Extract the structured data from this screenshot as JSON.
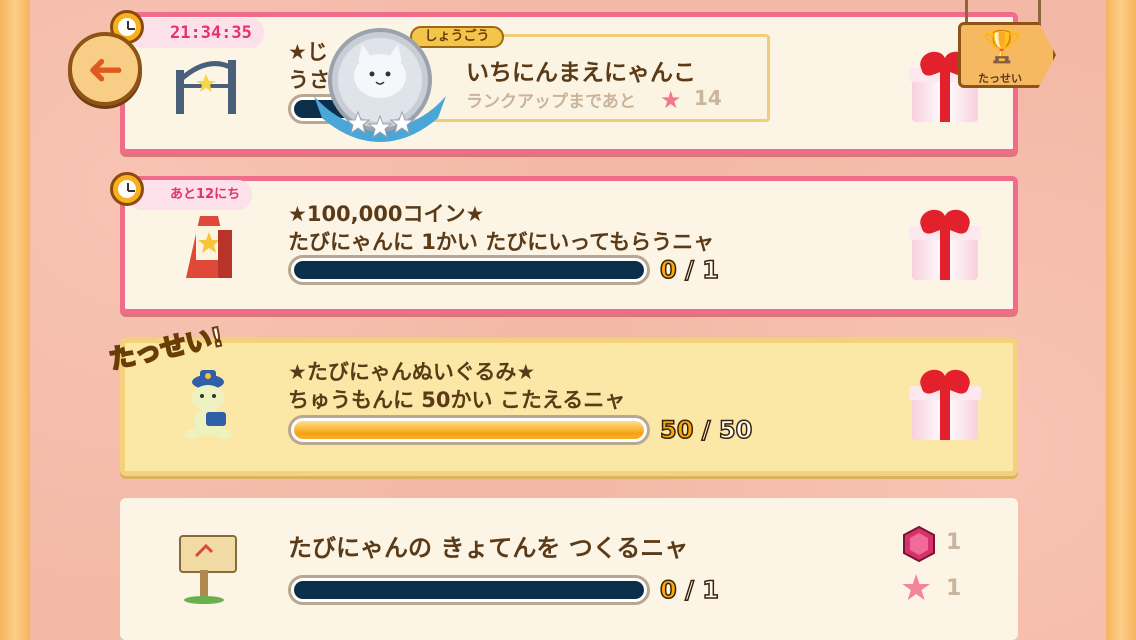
{
  "header": {
    "timer": "21:34:35",
    "title_tag": "しょうごう",
    "rank_name": "いちにんまえにゃんこ",
    "rank_up_text": "ランクアップまであと",
    "rank_up_count": "14",
    "achievement_label": "たっせい"
  },
  "missions": [
    {
      "time_badge": "21:34:35",
      "title": "★じ",
      "desc": "うさ"
    },
    {
      "time_badge": "あと12にち",
      "title": "★100,000コイン★",
      "desc": "たびにゃんに 1かい たびにいってもらうニャ",
      "progress_current": "0",
      "progress_slash": "/",
      "progress_total": "1",
      "progress_fraction": 0
    },
    {
      "status_badge": "たっせい!",
      "title": "★たびにゃんぬいぐるみ★",
      "desc": "ちゅうもんに 50かい こたえるニャ",
      "progress_current": "50",
      "progress_slash": "/",
      "progress_total": "50",
      "progress_fraction": 1
    },
    {
      "title": "たびにゃんの きょてんを つくるニャ",
      "progress_current": "0",
      "progress_slash": "/",
      "progress_total": "1",
      "progress_fraction": 0,
      "rewards": [
        {
          "icon": "gem-icon",
          "count": "1"
        },
        {
          "icon": "star-icon",
          "count": "1"
        }
      ]
    }
  ],
  "colors": {
    "pink_border": "#f16b8a",
    "gold_card": "#fbe7a6",
    "progress_empty": "#0b2f4a",
    "progress_full": "#f6a112",
    "text_brown": "#5a3a17"
  }
}
